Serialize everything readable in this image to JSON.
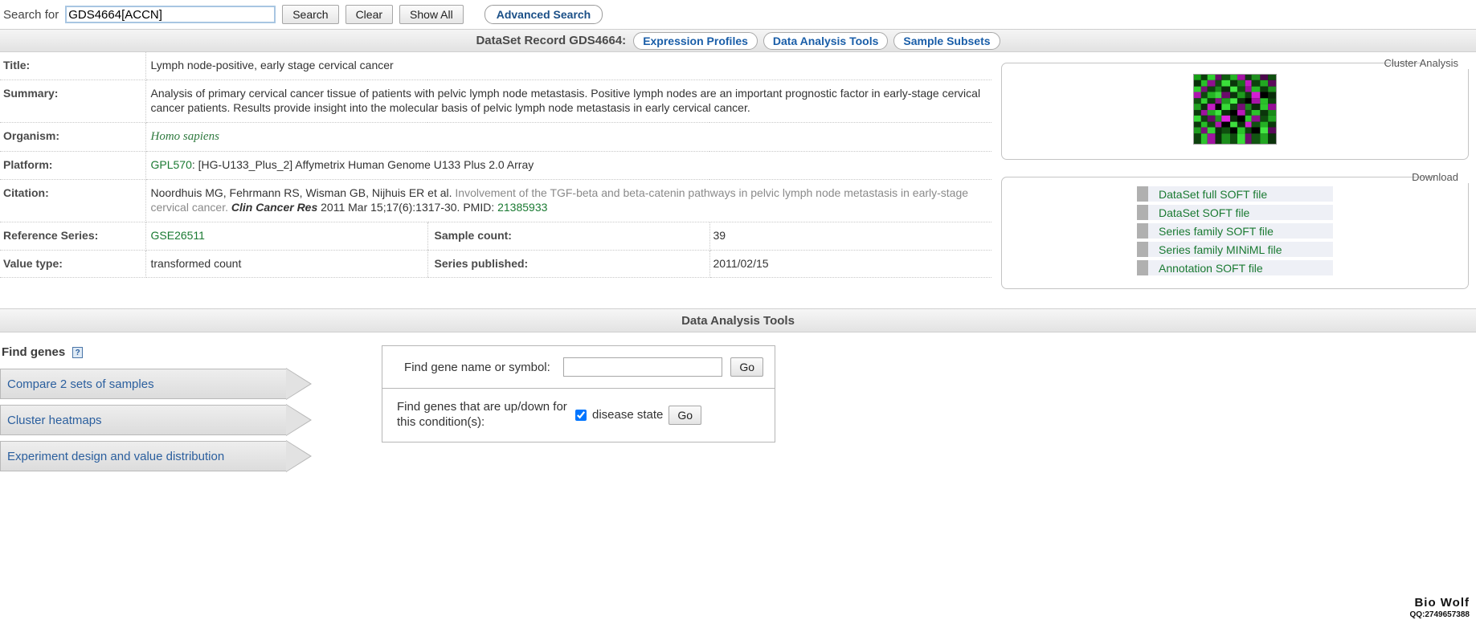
{
  "search": {
    "label": "Search for",
    "value": "GDS4664[ACCN]",
    "placeholder": "",
    "search_button": "Search",
    "clear_button": "Clear",
    "show_all_button": "Show All",
    "advanced_search": "Advanced Search"
  },
  "record_header": {
    "title": "DataSet Record GDS4664:",
    "pills": [
      "Expression Profiles",
      "Data Analysis Tools",
      "Sample Subsets"
    ]
  },
  "record": {
    "title_label": "Title:",
    "title_value": "Lymph node-positive, early stage cervical cancer",
    "summary_label": "Summary:",
    "summary_value": "Analysis of primary cervical cancer tissue of patients with pelvic lymph node metastasis. Positive lymph nodes are an important prognostic factor in early-stage cervical cancer patients. Results provide insight into the molecular basis of pelvic lymph node metastasis in early cervical cancer.",
    "organism_label": "Organism:",
    "organism_value": "Homo sapiens",
    "platform_label": "Platform:",
    "platform_accession": "GPL570",
    "platform_desc": ": [HG-U133_Plus_2] Affymetrix Human Genome U133 Plus 2.0 Array",
    "citation_label": "Citation:",
    "citation_authors": "Noordhuis MG, Fehrmann RS, Wisman GB, Nijhuis ER et al.",
    "citation_title": "Involvement of the TGF-beta and beta-catenin pathways in pelvic lymph node metastasis in early-stage cervical cancer.",
    "citation_journal": "Clin Cancer Res",
    "citation_details": "2011 Mar 15;17(6):1317-30. PMID:",
    "citation_pmid": "21385933",
    "reference_series_label": "Reference Series:",
    "reference_series_value": "GSE26511",
    "sample_count_label": "Sample count:",
    "sample_count_value": "39",
    "value_type_label": "Value type:",
    "value_type_value": "transformed count",
    "series_published_label": "Series published:",
    "series_published_value": "2011/02/15"
  },
  "sidebar": {
    "cluster_legend": "Cluster Analysis",
    "cluster_image_name": "cluster-heatmap-thumbnail",
    "download_legend": "Download",
    "downloads": [
      "DataSet full SOFT file",
      "DataSet SOFT file",
      "Series family SOFT file",
      "Series family MINiML file",
      "Annotation SOFT file"
    ]
  },
  "analysis": {
    "bar_title": "Data Analysis Tools",
    "find_genes_label": "Find genes",
    "help_glyph": "?",
    "tool_links": [
      "Compare 2 sets of samples",
      "Cluster heatmaps",
      "Experiment design and value distribution"
    ],
    "gene_name_label": "Find gene name or symbol:",
    "gene_name_value": "",
    "gene_name_placeholder": "",
    "gene_go_button": "Go",
    "updown_label": "Find genes that are up/down for this condition(s):",
    "condition_checkbox_label": "disease state",
    "condition_checked": true,
    "updown_go_button": "Go"
  },
  "watermark": {
    "name": "Bio Wolf",
    "qq": "QQ:2749657388"
  },
  "colors": {
    "link_green": "#1a7a32",
    "link_blue": "#1a5ea8",
    "header_gray": "#4a4a4a"
  }
}
